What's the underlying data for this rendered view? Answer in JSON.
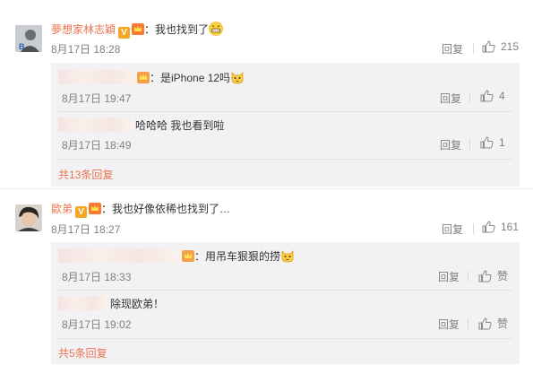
{
  "comments": [
    {
      "username": "夢想家林志穎",
      "text": "：我也找到了",
      "timestamp": "8月17日 18:28",
      "reply_label": "回复",
      "like_count": "215",
      "replies": [
        {
          "text": "：是iPhone 12吗",
          "timestamp": "8月17日 19:47",
          "reply_label": "回复",
          "like_count": "4"
        },
        {
          "text": "哈哈哈  我也看到啦",
          "timestamp": "8月17日 18:49",
          "reply_label": "回复",
          "like_count": "1"
        }
      ],
      "more_replies": "共13条回复"
    },
    {
      "username": "歐弟",
      "text": "：我也好像依稀也找到了…",
      "timestamp": "8月17日 18:27",
      "reply_label": "回复",
      "like_count": "161",
      "replies": [
        {
          "text": "：用吊车狠狠的捞",
          "timestamp": "8月17日 18:33",
          "reply_label": "回复",
          "like_count": "赞"
        },
        {
          "text": "除现欧弟！",
          "timestamp": "8月17日 19:02",
          "reply_label": "回复",
          "like_count": "赞"
        }
      ],
      "more_replies": "共5条回复"
    }
  ],
  "badges": {
    "verified_letter": "V"
  },
  "colors": {
    "username": "#eb7350",
    "meta": "#808080",
    "reply_bg": "#f2f2f5"
  },
  "icons": {
    "like": "thumbs-up-icon",
    "emoji_grin": "grin-emoji-icon",
    "emoji_cat": "cat-emoji-icon",
    "crown": "crown-badge-icon"
  }
}
